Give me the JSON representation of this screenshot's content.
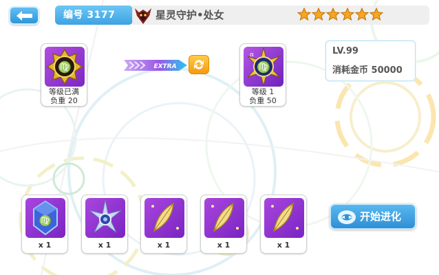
{
  "header": {
    "id_label": "编号 3177",
    "title": "星灵守护•处女",
    "star_count": 6,
    "unit_icon": "demon-crest-icon"
  },
  "current_card": {
    "level": "等级已满",
    "weight": "负重 20",
    "icon": "virgo-gold-emblem"
  },
  "extra_label": "EXTRA",
  "evolved_card": {
    "level": "等级 1",
    "weight": "负重 50",
    "icon": "virgo-star-emblem"
  },
  "info": {
    "level": "LV.99",
    "cost": "消耗金币 50000"
  },
  "materials": [
    {
      "icon": "virgo-crystal-icon",
      "qty": "x 1"
    },
    {
      "icon": "star-orb-icon",
      "qty": "x 1"
    },
    {
      "icon": "gold-leaf-icon",
      "qty": "x 1"
    },
    {
      "icon": "gold-leaf-icon",
      "qty": "x 1"
    },
    {
      "icon": "gold-leaf-icon",
      "qty": "x 1"
    }
  ],
  "evolve_button": "开始进化",
  "colors": {
    "accent_blue": "#3ea3e2",
    "gold": "#f5a623",
    "purple": "#8a2fcf"
  }
}
